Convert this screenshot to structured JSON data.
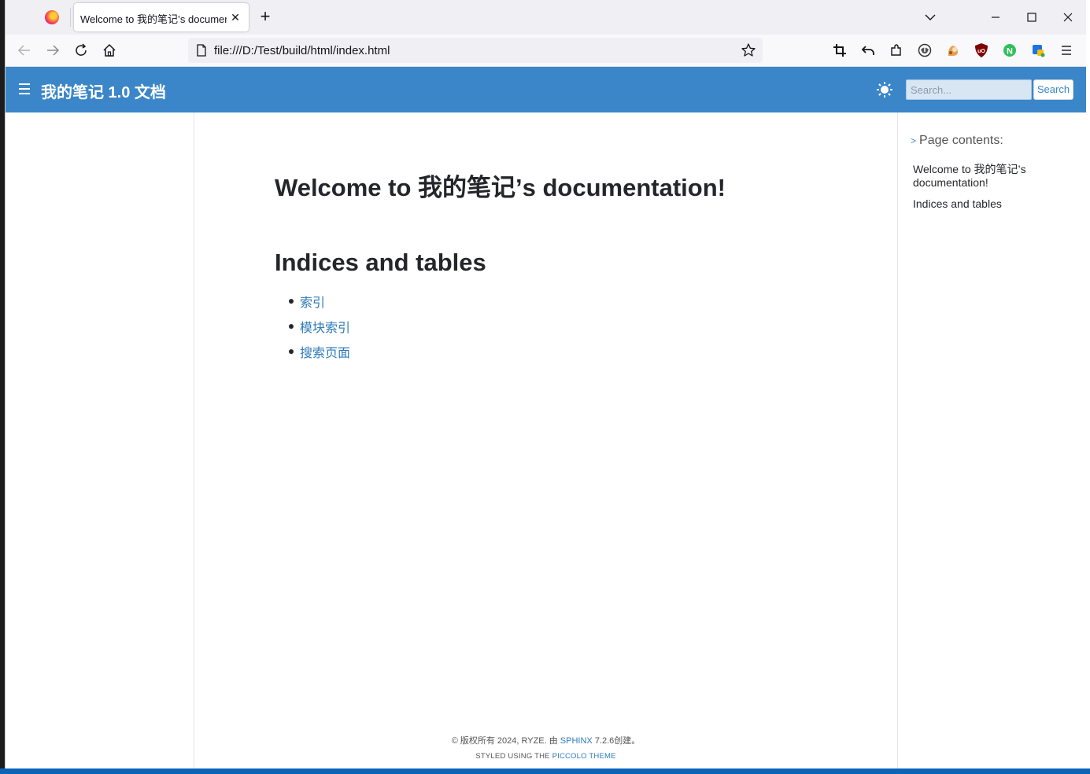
{
  "browser": {
    "tab_title": "Welcome to 我的笔记’s documentation",
    "tab_close": "✕",
    "new_tab": "+",
    "url": "file:///D:/Test/build/html/index.html"
  },
  "site": {
    "title": "我的笔记 1.0 文档",
    "search_placeholder": "Search...",
    "search_button": "Search"
  },
  "content": {
    "page_title": "Welcome to 我的笔记’s documentation!",
    "section_heading": "Indices and tables",
    "links": [
      "索引",
      "模块索引",
      "搜索页面"
    ]
  },
  "toc": {
    "heading": "Page contents:",
    "arrow": ">",
    "items": [
      "Welcome to 我的笔记’s documentation!",
      "Indices and tables"
    ]
  },
  "footer": {
    "copyright_prefix": "© 版权所有 2024, RYZE. 由 ",
    "copyright_link": "SPHINX",
    "copyright_suffix": " 7.2.6创建。",
    "styled_prefix": "STYLED USING THE ",
    "styled_link": "PICCOLO THEME"
  },
  "colors": {
    "header_bg": "#3a86c8",
    "link": "#2e7ab8"
  }
}
